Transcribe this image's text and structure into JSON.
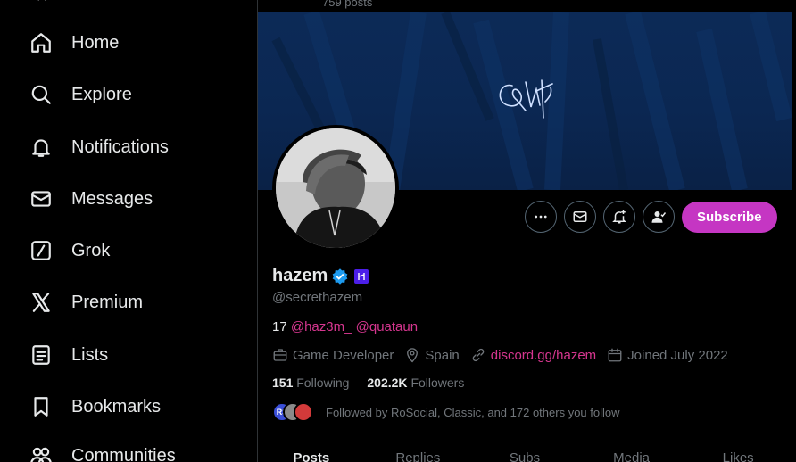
{
  "sidebar": {
    "items": [
      {
        "label": "Home",
        "icon": "home-icon"
      },
      {
        "label": "Explore",
        "icon": "search-icon"
      },
      {
        "label": "Notifications",
        "icon": "bell-icon"
      },
      {
        "label": "Messages",
        "icon": "envelope-icon"
      },
      {
        "label": "Grok",
        "icon": "grok-icon"
      },
      {
        "label": "Premium",
        "icon": "x-logo-icon"
      },
      {
        "label": "Lists",
        "icon": "list-icon"
      },
      {
        "label": "Bookmarks",
        "icon": "bookmark-icon"
      },
      {
        "label": "Communities",
        "icon": "communities-icon"
      }
    ]
  },
  "header": {
    "posts_count": "759 posts"
  },
  "profile": {
    "display_name": "hazem",
    "handle": "@secrethazem",
    "bio": {
      "prefix": "17 ",
      "mention1": "@haz3m_",
      "mention2": "@quataun"
    },
    "meta": {
      "profession": "Game Developer",
      "location": "Spain",
      "link": "discord.gg/hazem",
      "joined": "Joined July 2022"
    },
    "stats": {
      "following_count": "151",
      "following_label": "Following",
      "followers_count": "202.2K",
      "followers_label": "Followers"
    },
    "followed_by": "Followed by RoSocial, Classic, and 172 others you follow",
    "followed_avatars": [
      "RS",
      "",
      ""
    ],
    "subscribe_label": "Subscribe"
  },
  "tabs": [
    "Posts",
    "Replies",
    "Subs",
    "Media",
    "Likes"
  ],
  "colors": {
    "accent": "#c536c3",
    "link": "#d6368f",
    "verified": "#1d9bf0",
    "banner": "#0c2a57"
  }
}
